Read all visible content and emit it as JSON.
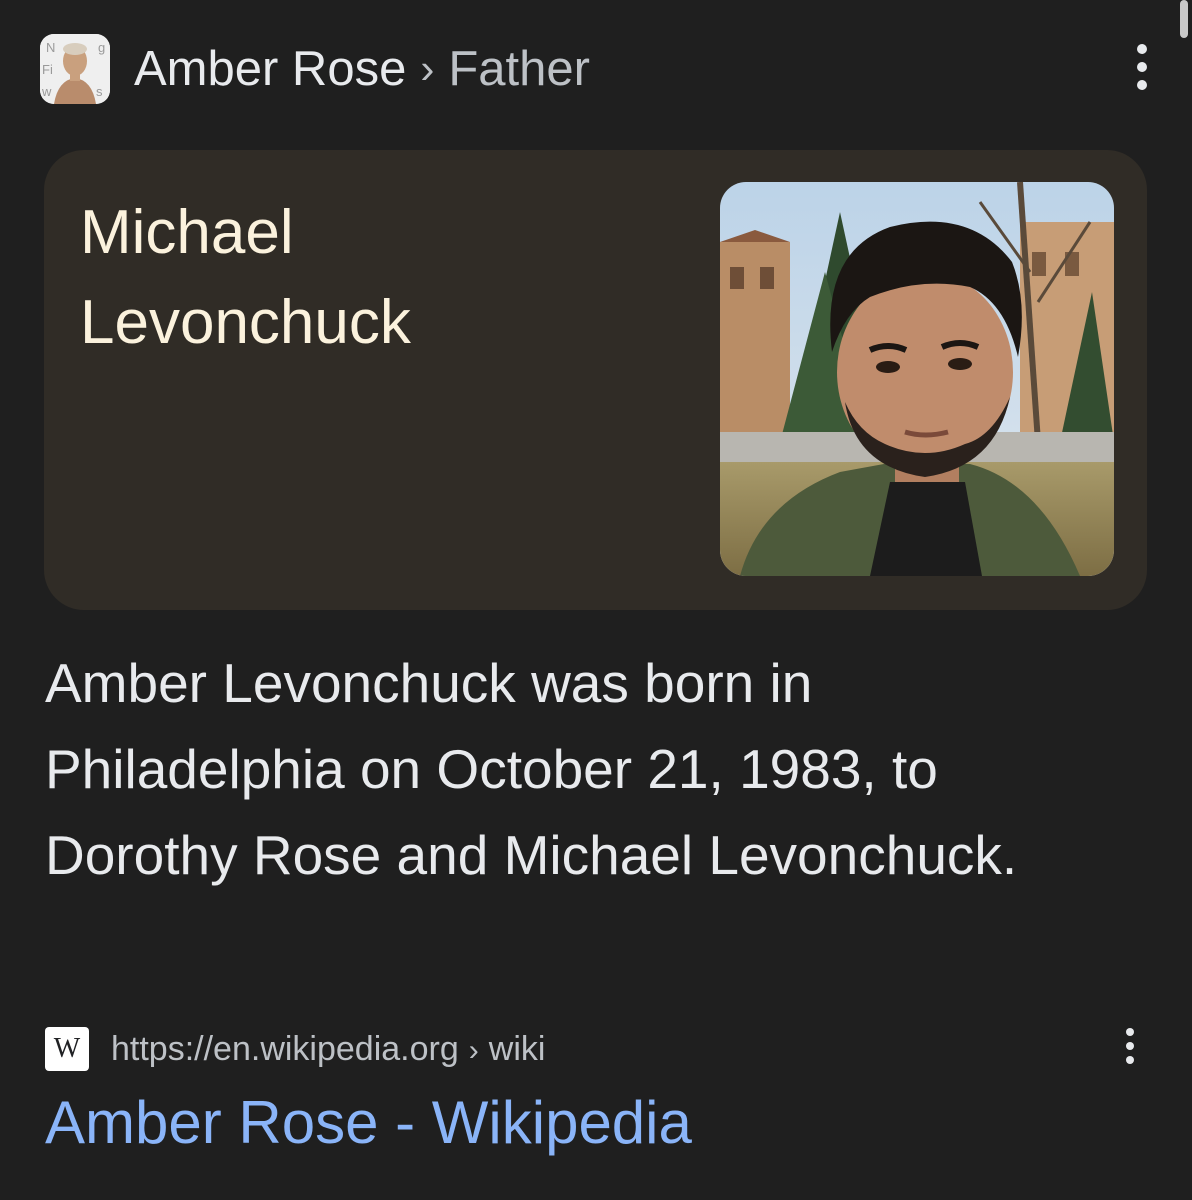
{
  "header": {
    "thumbnail_icon": "amber-rose-portrait-thumbnail",
    "entity": "Amber Rose",
    "separator": "›",
    "attribute": "Father",
    "menu_icon": "more-vert-icon"
  },
  "answer_card": {
    "title": "Michael Levonchuck",
    "photo": "portrait-photo"
  },
  "snippet": {
    "text": "Amber Levonchuck was born in Philadelphia on October 21, 1983, to Dorothy Rose and Michael Levonchuck."
  },
  "source": {
    "logo_letter": "W",
    "url": "https://en.wikipedia.org",
    "separator": "›",
    "path": "wiki",
    "menu_icon": "more-vert-icon"
  },
  "result": {
    "title": "Amber Rose - Wikipedia"
  },
  "colors": {
    "background": "#1f1f1f",
    "card": "#302c26",
    "card_text": "#fbf2dd",
    "link": "#8ab4f8",
    "text": "#e8eaed",
    "muted": "#bdc1c6"
  }
}
